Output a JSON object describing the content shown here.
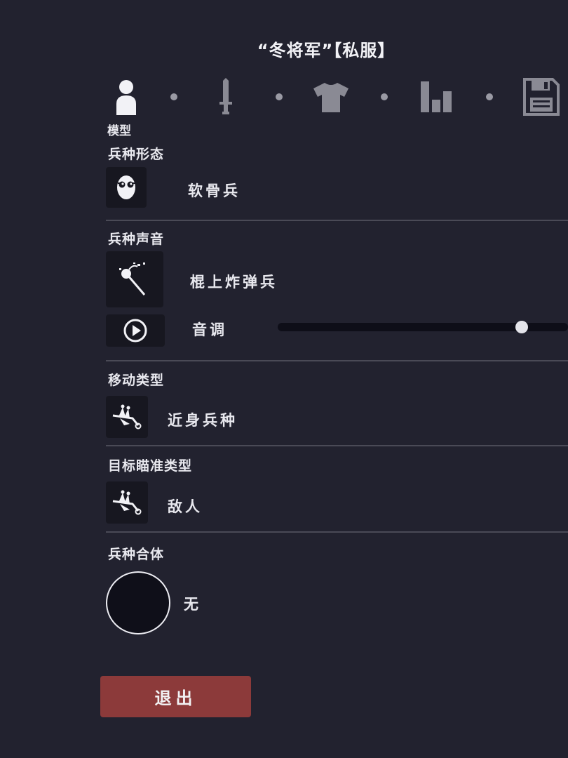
{
  "title": "“冬将军”【私服】",
  "tabs": {
    "active_label": "模型",
    "items": [
      {
        "icon": "person-icon",
        "active": true
      },
      {
        "icon": "sword-icon",
        "active": false
      },
      {
        "icon": "shirt-icon",
        "active": false
      },
      {
        "icon": "bar-chart-icon",
        "active": false
      },
      {
        "icon": "save-disk-icon",
        "active": false
      }
    ]
  },
  "sections": {
    "unit_form": {
      "title": "兵种形态",
      "value": "软骨兵",
      "icon": "skull-mask-icon"
    },
    "unit_voice": {
      "title": "兵种声音",
      "value": "棍上炸弹兵",
      "icon": "stick-bomb-icon",
      "play_icon": "play-icon",
      "pitch_label": "音调",
      "pitch_level": 0.84
    },
    "movement": {
      "title": "移动类型",
      "value": "近身兵种",
      "icon": "wheelbarrow-unit-icon"
    },
    "targeting": {
      "title": "目标瞄准类型",
      "value": "敌人",
      "icon": "wheelbarrow-unit-icon"
    },
    "combine": {
      "title": "兵种合体",
      "value": "无"
    }
  },
  "exit_button": {
    "label": "退出"
  },
  "colors": {
    "background": "#22222f",
    "panel": "#171720",
    "exit": "#8c3a3a",
    "tab_inactive": "#8a8a94"
  }
}
